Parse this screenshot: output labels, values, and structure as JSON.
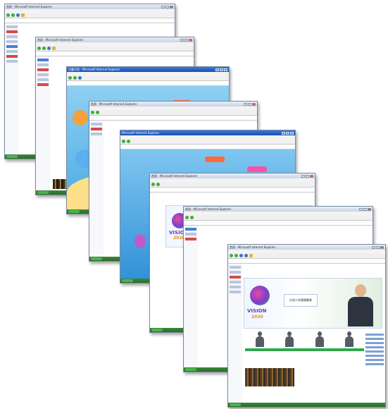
{
  "windows": [
    {
      "title": "首頁 - Microsoft Internet Explorer"
    },
    {
      "title": "首頁 - Microsoft Internet Explorer"
    },
    {
      "title": "兒童天地 - Microsoft Internet Explorer"
    },
    {
      "title": "首頁 - Microsoft Internet Explorer"
    },
    {
      "title": "Microsoft Internet Explorer"
    },
    {
      "title": "首頁 - Microsoft Internet Explorer"
    },
    {
      "title": "首頁 - Microsoft Internet Explorer"
    },
    {
      "title": "首頁 - Microsoft Internet Explorer"
    }
  ],
  "vision": {
    "name": "VISION",
    "year": "2020",
    "banner_caption": "台灣人的閱讀願景"
  },
  "colors": {
    "taskbar": "#2b6b2b",
    "accent_blue": "#3a7bd5",
    "vision_purple": "#6a3db8",
    "vision_orange": "#e68a1a"
  },
  "icons": [
    "back-icon",
    "forward-icon",
    "stop-icon",
    "refresh-icon",
    "home-icon",
    "search-icon",
    "favorites-icon"
  ]
}
